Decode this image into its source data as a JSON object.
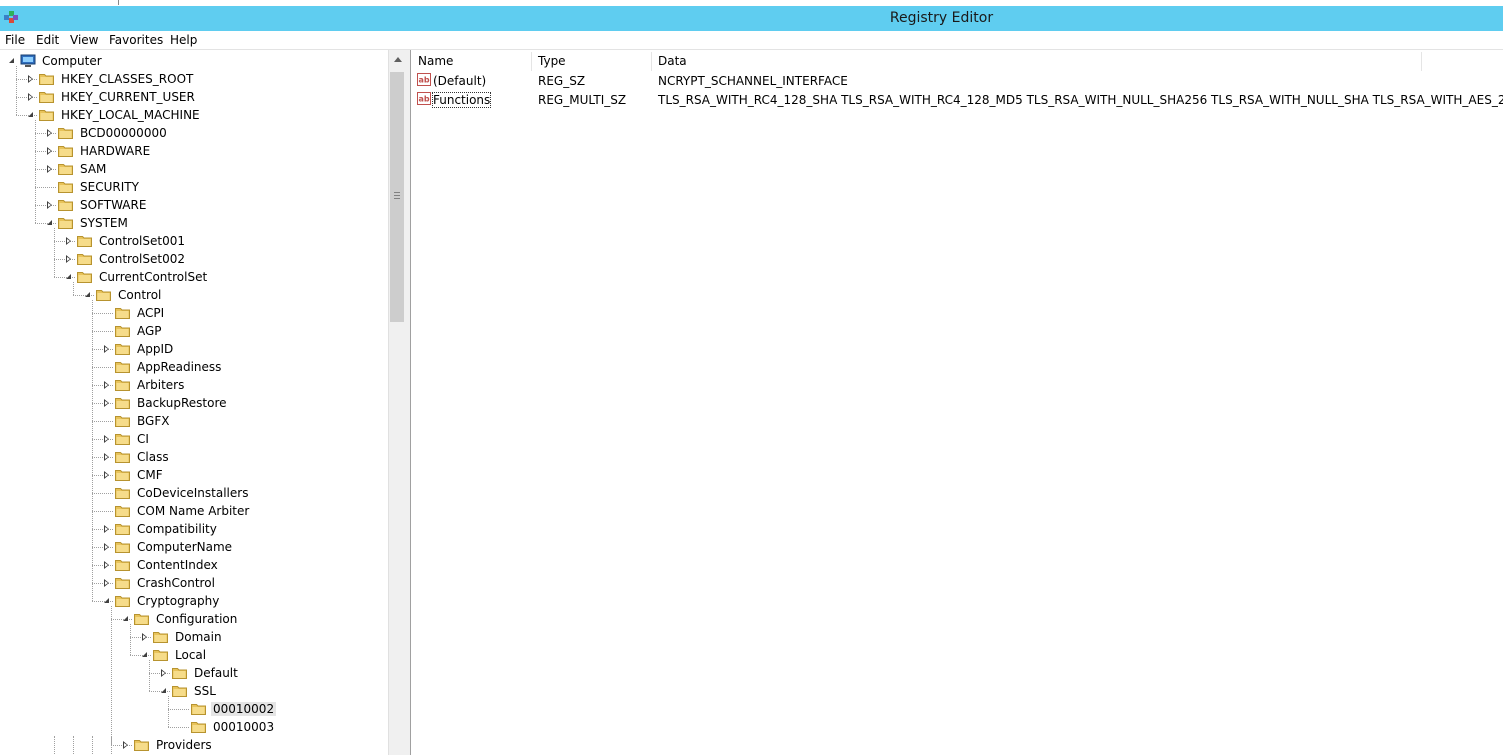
{
  "window": {
    "title": "Registry Editor"
  },
  "menu": [
    "File",
    "Edit",
    "View",
    "Favorites",
    "Help"
  ],
  "tree": [
    {
      "label": "Computer",
      "level": 0,
      "expander": "open",
      "icon": "computer-icon"
    },
    {
      "label": "HKEY_CLASSES_ROOT",
      "level": 1,
      "expander": "closed"
    },
    {
      "label": "HKEY_CURRENT_USER",
      "level": 1,
      "expander": "closed"
    },
    {
      "label": "HKEY_LOCAL_MACHINE",
      "level": 1,
      "expander": "open"
    },
    {
      "label": "BCD00000000",
      "level": 2,
      "expander": "closed"
    },
    {
      "label": "HARDWARE",
      "level": 2,
      "expander": "closed"
    },
    {
      "label": "SAM",
      "level": 2,
      "expander": "closed"
    },
    {
      "label": "SECURITY",
      "level": 2,
      "expander": "none"
    },
    {
      "label": "SOFTWARE",
      "level": 2,
      "expander": "closed"
    },
    {
      "label": "SYSTEM",
      "level": 2,
      "expander": "open"
    },
    {
      "label": "ControlSet001",
      "level": 3,
      "expander": "closed"
    },
    {
      "label": "ControlSet002",
      "level": 3,
      "expander": "closed"
    },
    {
      "label": "CurrentControlSet",
      "level": 3,
      "expander": "open"
    },
    {
      "label": "Control",
      "level": 4,
      "expander": "open"
    },
    {
      "label": "ACPI",
      "level": 5,
      "expander": "none"
    },
    {
      "label": "AGP",
      "level": 5,
      "expander": "none"
    },
    {
      "label": "AppID",
      "level": 5,
      "expander": "closed"
    },
    {
      "label": "AppReadiness",
      "level": 5,
      "expander": "none"
    },
    {
      "label": "Arbiters",
      "level": 5,
      "expander": "closed"
    },
    {
      "label": "BackupRestore",
      "level": 5,
      "expander": "closed"
    },
    {
      "label": "BGFX",
      "level": 5,
      "expander": "none"
    },
    {
      "label": "CI",
      "level": 5,
      "expander": "closed"
    },
    {
      "label": "Class",
      "level": 5,
      "expander": "closed"
    },
    {
      "label": "CMF",
      "level": 5,
      "expander": "closed"
    },
    {
      "label": "CoDeviceInstallers",
      "level": 5,
      "expander": "none"
    },
    {
      "label": "COM Name Arbiter",
      "level": 5,
      "expander": "none"
    },
    {
      "label": "Compatibility",
      "level": 5,
      "expander": "closed"
    },
    {
      "label": "ComputerName",
      "level": 5,
      "expander": "closed"
    },
    {
      "label": "ContentIndex",
      "level": 5,
      "expander": "closed"
    },
    {
      "label": "CrashControl",
      "level": 5,
      "expander": "closed"
    },
    {
      "label": "Cryptography",
      "level": 5,
      "expander": "open"
    },
    {
      "label": "Configuration",
      "level": 6,
      "expander": "open"
    },
    {
      "label": "Domain",
      "level": 7,
      "expander": "closed"
    },
    {
      "label": "Local",
      "level": 7,
      "expander": "open"
    },
    {
      "label": "Default",
      "level": 8,
      "expander": "closed"
    },
    {
      "label": "SSL",
      "level": 8,
      "expander": "open"
    },
    {
      "label": "00010002",
      "level": 9,
      "expander": "none",
      "selected": true
    },
    {
      "label": "00010003",
      "level": 9,
      "expander": "none"
    },
    {
      "label": "Providers",
      "level": 6,
      "expander": "closed"
    }
  ],
  "list": {
    "columns": [
      "Name",
      "Type",
      "Data"
    ],
    "rows": [
      {
        "name": "(Default)",
        "type": "REG_SZ",
        "data": "NCRYPT_SCHANNEL_INTERFACE"
      },
      {
        "name": "Functions",
        "type": "REG_MULTI_SZ",
        "data": "TLS_RSA_WITH_RC4_128_SHA TLS_RSA_WITH_RC4_128_MD5 TLS_RSA_WITH_NULL_SHA256 TLS_RSA_WITH_NULL_SHA TLS_RSA_WITH_AES_2...",
        "focused": true
      }
    ]
  },
  "colors": {
    "titlebar": "#5fcdf0",
    "folder": "#e8c35a",
    "selection": "#e5e5e5"
  }
}
